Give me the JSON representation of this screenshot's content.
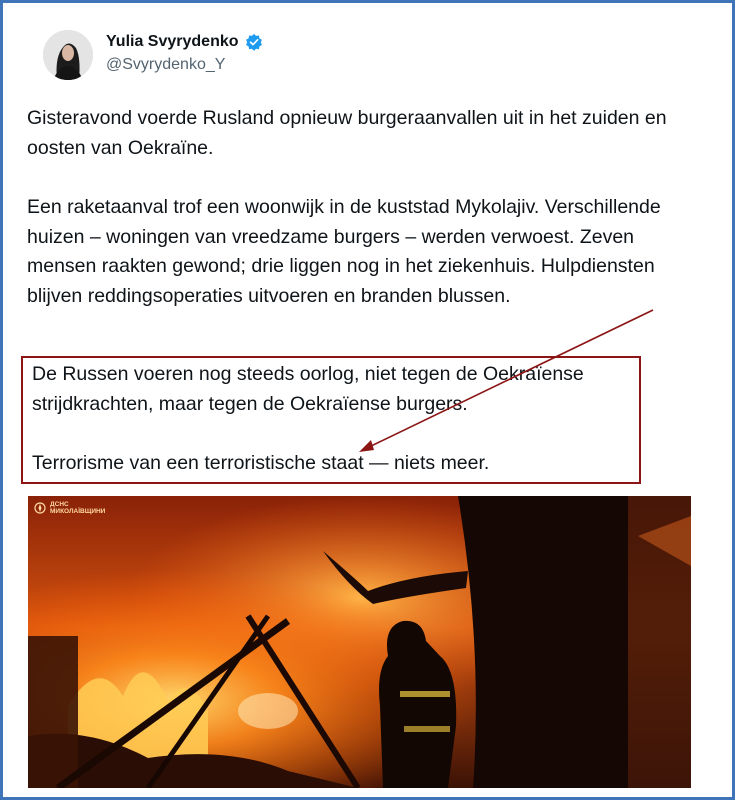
{
  "tweet": {
    "author_name": "Yulia Svyrydenko",
    "handle": "@Svyrydenko_Y",
    "paragraph1": "Gisteravond voerde Rusland opnieuw burgeraanvallen uit in het zuiden en oosten van Oekraïne.",
    "paragraph2": "Een raketaanval trof een woonwijk in de kuststad Mykolajiv. Verschillende huizen – woningen van vreedzame burgers – werden verwoest. Zeven mensen raakten gewond; drie liggen nog in het ziekenhuis. Hulpdiensten blijven reddingsoperaties uitvoeren en branden blussen.",
    "paragraph3": "De Russen voeren nog steeds oorlog, niet tegen de Oekraïense strijdkrachten, maar tegen de Oekraïense burgers.",
    "paragraph4": "Terrorisme van een terroristische staat — niets meer."
  },
  "photo": {
    "watermark_line1": "ДСНС",
    "watermark_line2": "МИКОЛАЇВЩИНИ"
  },
  "colors": {
    "frame": "#3f74b8",
    "highlight_box": "#8c1515",
    "verified_badge": "#1d9bf0"
  },
  "icons": [
    "verified-badge-icon",
    "dsns-emblem-icon"
  ]
}
